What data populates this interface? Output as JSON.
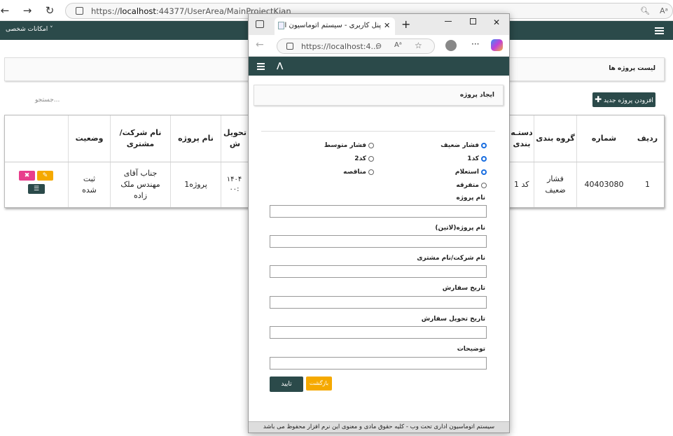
{
  "browser": {
    "url_prefix": "https://",
    "url_host": "localhost",
    "url_rest": ":44377/UserArea/MainProjectKian",
    "reader_label": "Aᵃ"
  },
  "topnav": {
    "personal_menu": "امکانات شخصی ˅"
  },
  "page": {
    "breadcrumb": "لیست پروژه ها",
    "add_button": "افزودن پروژه جدید",
    "search_placeholder": "جستجو..."
  },
  "table": {
    "headers": {
      "row": "ردیف",
      "number": "شماره",
      "group": "گروه بندی",
      "category": "دستـه بندی",
      "delivery": "تحویل ش",
      "project_name": "نام پروژه",
      "company": "نام شرکت/ مشتری",
      "status": "وضعیت"
    },
    "row": {
      "row": "1",
      "number": "40403080",
      "group": "فشار ضعیف",
      "category": "کد 1",
      "delivery": "۱۴۰۴ ۰۰:",
      "project_name": "پروژه1",
      "company": "جناب آقای مهندس ملک زاده",
      "status": "ثبت شده"
    }
  },
  "popup": {
    "tab_title": "پنل کاربری - سیستم اتوماسیون ادا",
    "url": "https://localhost:4...",
    "card_title": "ایجاد پروژه",
    "radios": {
      "weak_pressure": "فشار ضعیف",
      "medium_pressure": "فشار متوسط",
      "code1": "کد1",
      "code2": "کد2",
      "inquiry": "استعلام",
      "tender": "مناقصه",
      "misc": "متفرقه"
    },
    "fields": {
      "project_name": "نام پروژه",
      "project_name_latin": "نام پروژه(لاتین)",
      "company": "نام شرکت/نام مشتری",
      "order_date": "تاریخ سفارش",
      "delivery_date": "تاریخ تحویل سفارش",
      "description": "توضیحات"
    },
    "confirm": "تایید",
    "back": "بازگشت",
    "footer": "سیستم اتوماسیون اداری تحت وب - کلیه حقوق مادی و معنوی این نرم افزار محفوظ می باشد"
  },
  "colors": {
    "primary": "#2b4a4a",
    "accent_yellow": "#f5a900",
    "danger_pink": "#e83e8c"
  }
}
